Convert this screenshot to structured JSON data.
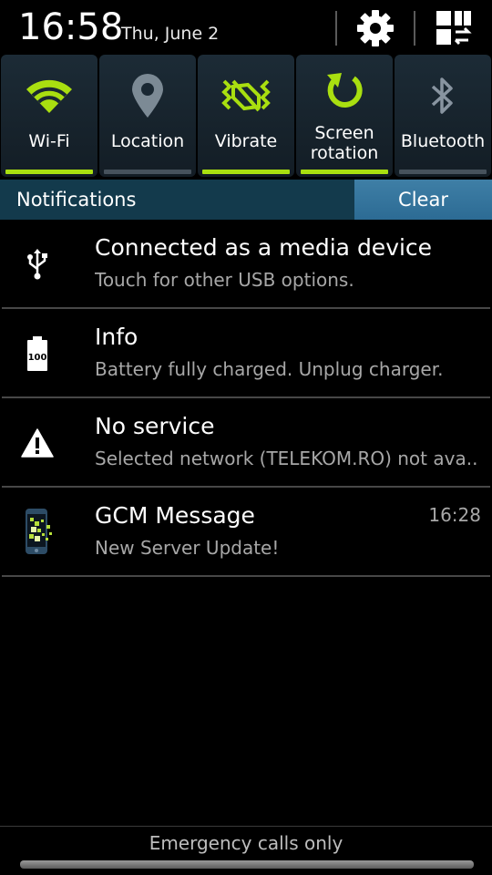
{
  "status": {
    "time": "16:58",
    "date": "Thu, June 2"
  },
  "header_buttons": [
    {
      "name": "settings",
      "icon": "gear-icon"
    },
    {
      "name": "edit-quick-settings",
      "icon": "grid-swap-icon"
    }
  ],
  "quick_settings": [
    {
      "label": "Wi-Fi",
      "icon": "wifi-icon",
      "on": true
    },
    {
      "label": "Location",
      "icon": "location-pin-icon",
      "on": false
    },
    {
      "label": "Vibrate",
      "icon": "vibrate-icon",
      "on": true
    },
    {
      "label": "Screen\nrotation",
      "icon": "rotation-icon",
      "on": true
    },
    {
      "label": "Bluetooth",
      "icon": "bluetooth-icon",
      "on": false
    }
  ],
  "notifications_panel": {
    "title": "Notifications",
    "clear_label": "Clear"
  },
  "notifications": [
    {
      "icon": "usb-icon",
      "title": "Connected as a media device",
      "subtitle": "Touch for other USB options.",
      "time": ""
    },
    {
      "icon": "battery-full-icon",
      "battery_text": "100",
      "title": "Info",
      "subtitle": "Battery fully charged. Unplug charger.",
      "time": ""
    },
    {
      "icon": "warning-icon",
      "title": "No service",
      "subtitle": "Selected network (TELEKOM.RO) not ava..",
      "time": ""
    },
    {
      "icon": "app-phone-icon",
      "title": "GCM Message",
      "subtitle": "New Server Update!",
      "time": "16:28"
    }
  ],
  "footer": {
    "carrier_text": "Emergency calls only"
  },
  "colors": {
    "accent_green": "#a9df10",
    "header_blue": "#133a4c",
    "clear_blue": "#2c6b94",
    "tile_bg": "#1c2b36"
  }
}
